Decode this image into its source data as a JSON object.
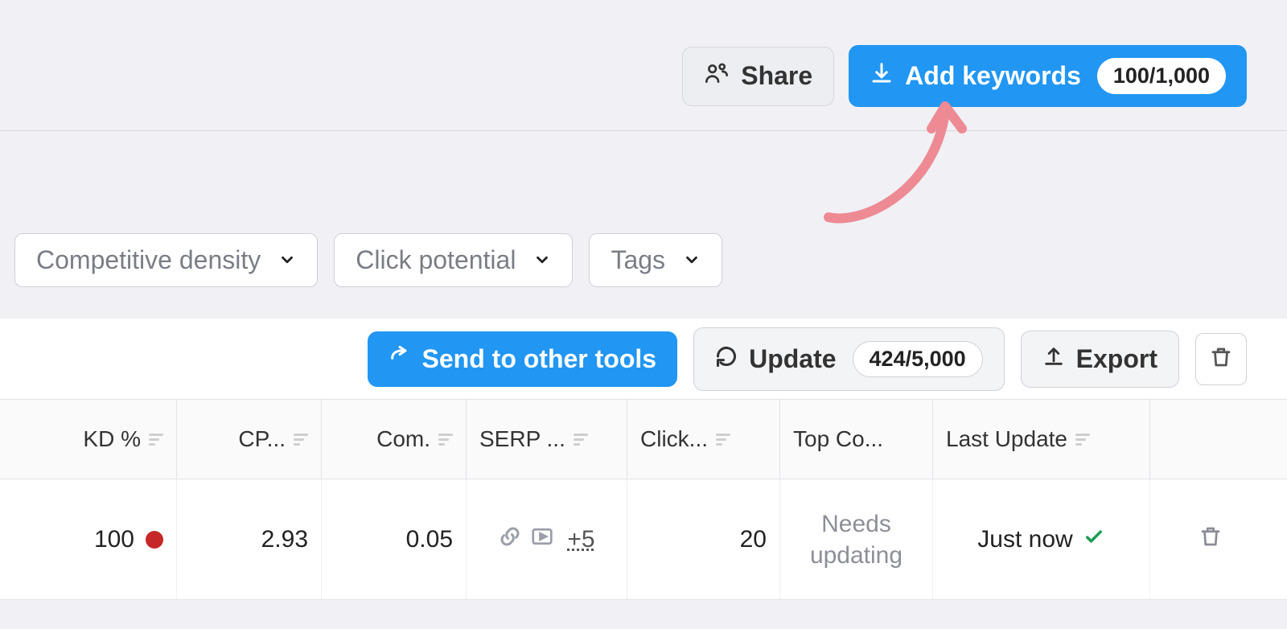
{
  "header": {
    "share_label": "Share",
    "add_keywords_label": "Add keywords",
    "keywords_count_badge": "100/1,000"
  },
  "filters": {
    "competitive_density": "Competitive density",
    "click_potential": "Click potential",
    "tags": "Tags"
  },
  "toolbar": {
    "send_label": "Send to other tools",
    "update_label": "Update",
    "update_badge": "424/5,000",
    "export_label": "Export"
  },
  "columns": {
    "kd": "KD %",
    "cp": "CP...",
    "com": "Com.",
    "serp": "SERP ...",
    "click": "Click...",
    "top": "Top Co...",
    "last": "Last Update"
  },
  "row": {
    "kd": "100",
    "cp": "2.93",
    "com": "0.05",
    "serp_more": "+5",
    "click": "20",
    "top": "Needs updating",
    "last": "Just now"
  },
  "colors": {
    "primary": "#2196f3",
    "dot": "#c62828",
    "check": "#1a9d52"
  }
}
